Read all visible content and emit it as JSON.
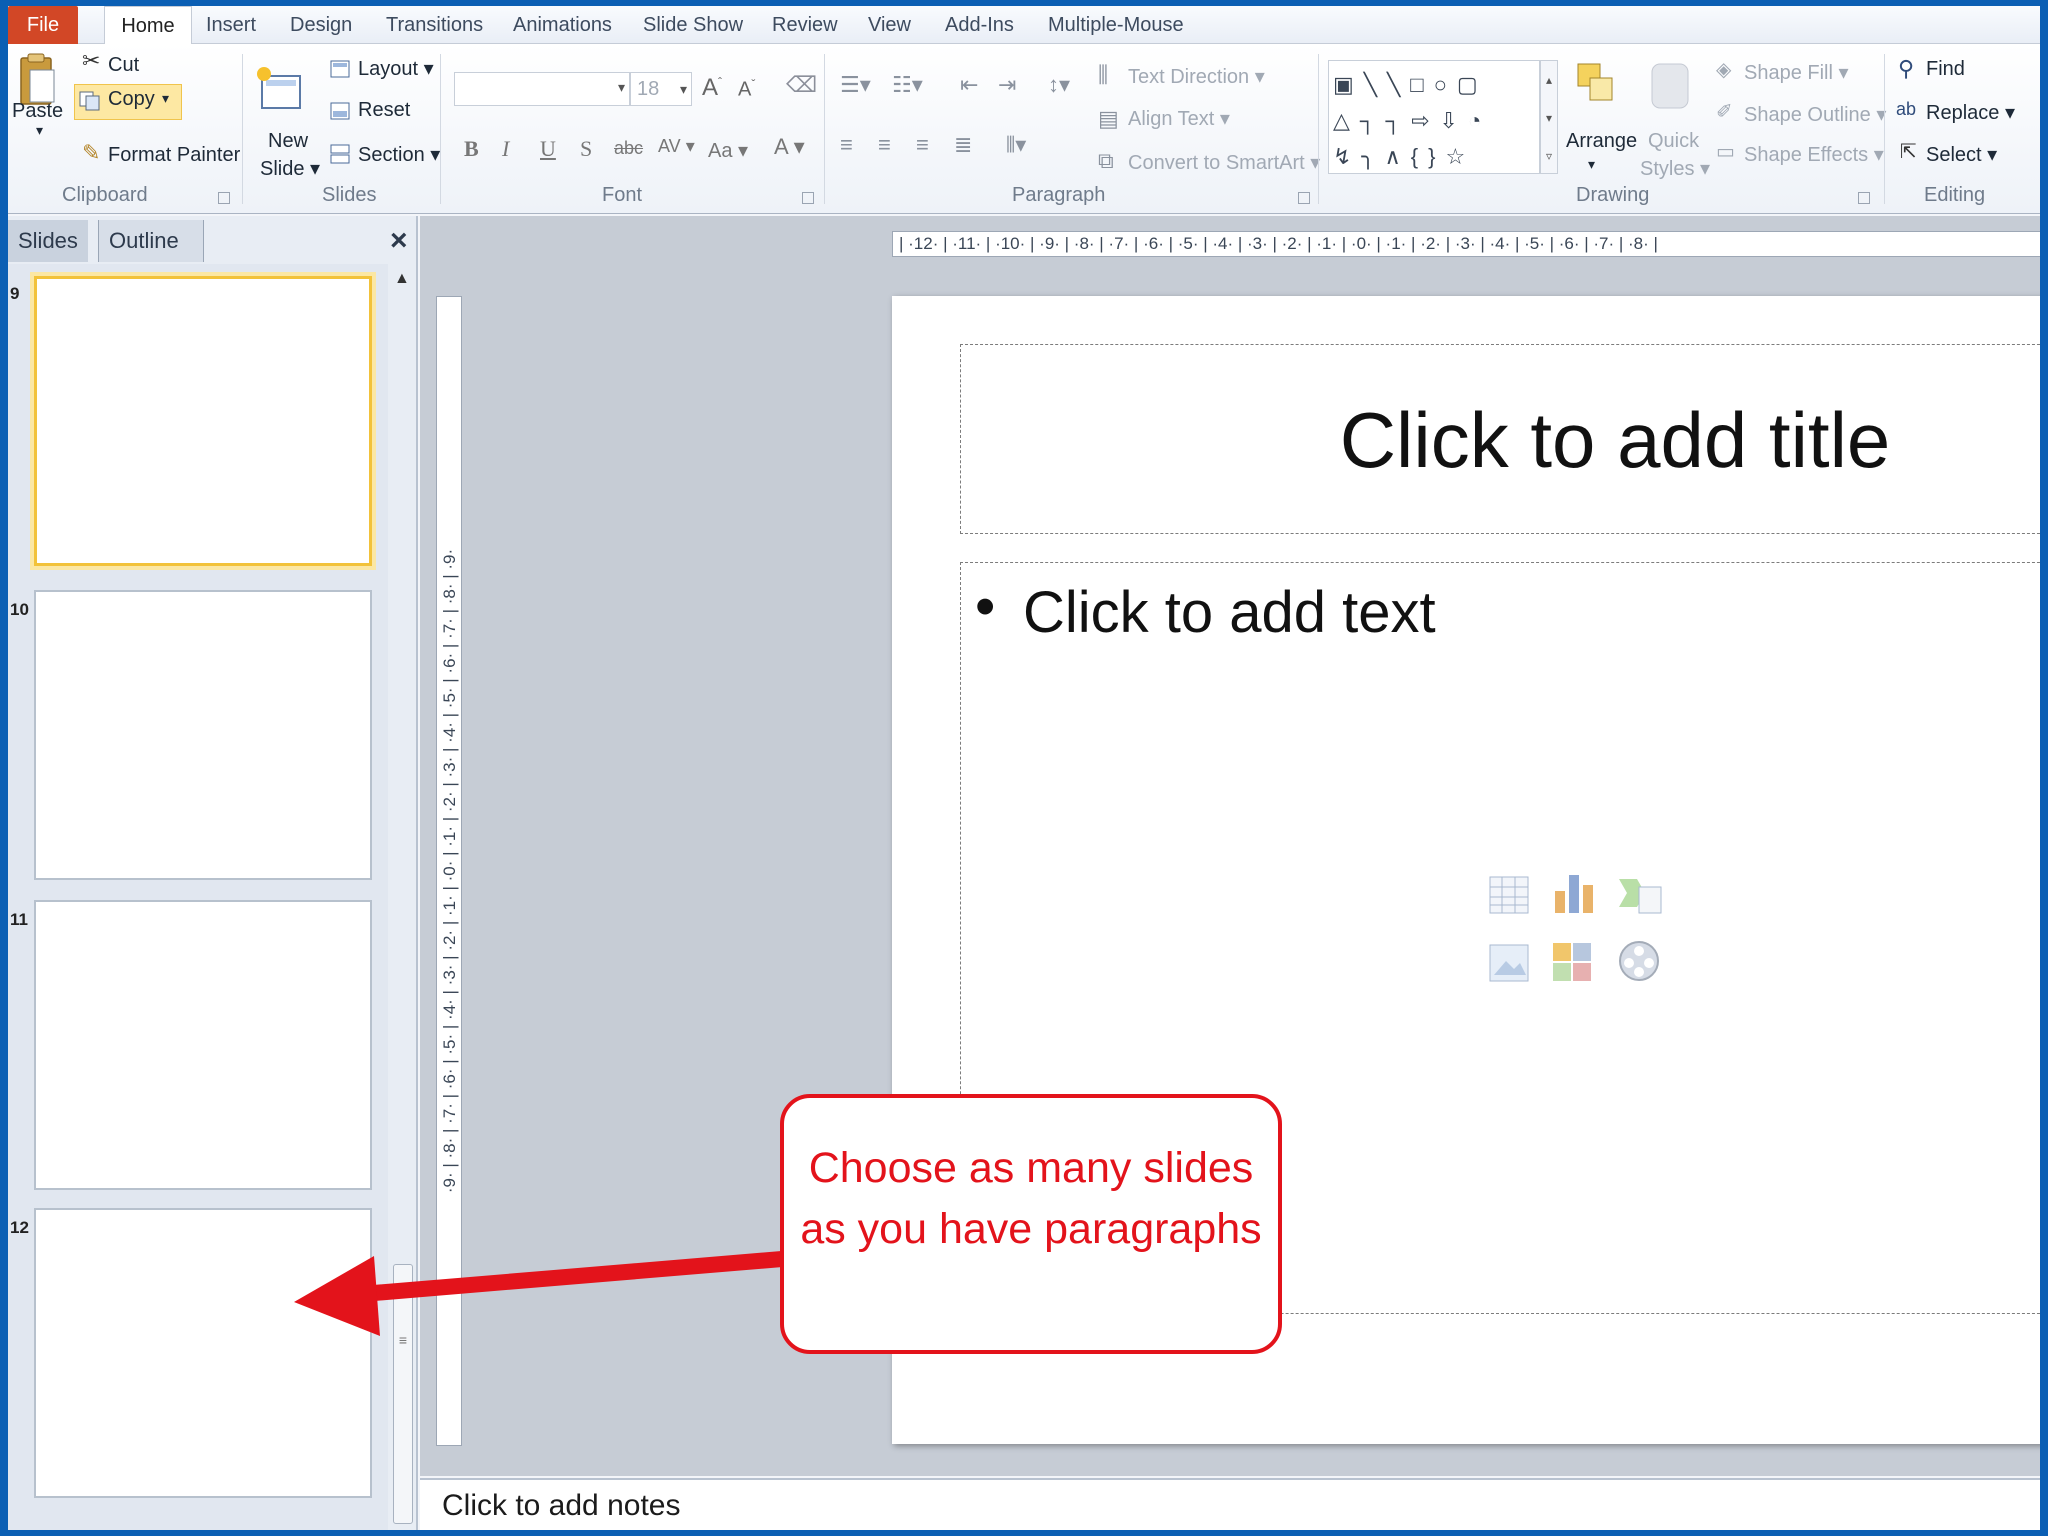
{
  "ribbon_tabs": [
    "File",
    "Home",
    "Insert",
    "Design",
    "Transitions",
    "Animations",
    "Slide Show",
    "Review",
    "View",
    "Add-Ins",
    "Multiple-Mouse"
  ],
  "clipboard": {
    "paste": "Paste",
    "cut": "Cut",
    "copy": "Copy",
    "format_painter": "Format Painter",
    "group": "Clipboard"
  },
  "slides_group": {
    "new": "New",
    "slide": "Slide",
    "layout": "Layout",
    "reset": "Reset",
    "section": "Section",
    "group": "Slides"
  },
  "font_group": {
    "size": "18",
    "bold": "B",
    "italic": "I",
    "underline": "U",
    "shadow": "S",
    "strike": "abc",
    "spacing": "AV",
    "case": "Aa",
    "color": "A",
    "group": "Font"
  },
  "paragraph_group": {
    "text_direction": "Text Direction",
    "align_text": "Align Text",
    "convert_smartart": "Convert to SmartArt",
    "group": "Paragraph"
  },
  "drawing_group": {
    "arrange": "Arrange",
    "quick": "Quick",
    "styles": "Styles",
    "shape_fill": "Shape Fill",
    "shape_outline": "Shape Outline",
    "shape_effects": "Shape Effects",
    "group": "Drawing"
  },
  "editing_group": {
    "find": "Find",
    "replace": "Replace",
    "select": "Select",
    "group": "Editing"
  },
  "left_pane": {
    "tab_slides": "Slides",
    "tab_outline": "Outline",
    "close": "×",
    "thumbs": [
      "9",
      "10",
      "11",
      "12"
    ]
  },
  "ruler": {
    "horizontal": "| ·12· | ·11· | ·10· | ·9· | ·8· | ·7· | ·6· | ·5· | ·4· | ·3· | ·2· | ·1· | ·0· | ·1· | ·2· | ·3· | ·4· | ·5· | ·6· | ·7· | ·8· |",
    "vertical": "·9· | ·8· | ·7· | ·6· | ·5· | ·4· | ·3· | ·2· | ·1· | ·0· | ·1· | ·2· | ·3· | ·4· | ·5· | ·6· | ·7· | ·8· | ·9·"
  },
  "slide": {
    "title": "Click to add title",
    "bullet": "•",
    "body": "Click to add text"
  },
  "notes": "Click to add notes",
  "callout": {
    "text": "Choose as many slides as you have paragraphs"
  },
  "colors": {
    "accent": "#d24726",
    "callout": "#e3131b",
    "selection": "#f2c23a"
  }
}
